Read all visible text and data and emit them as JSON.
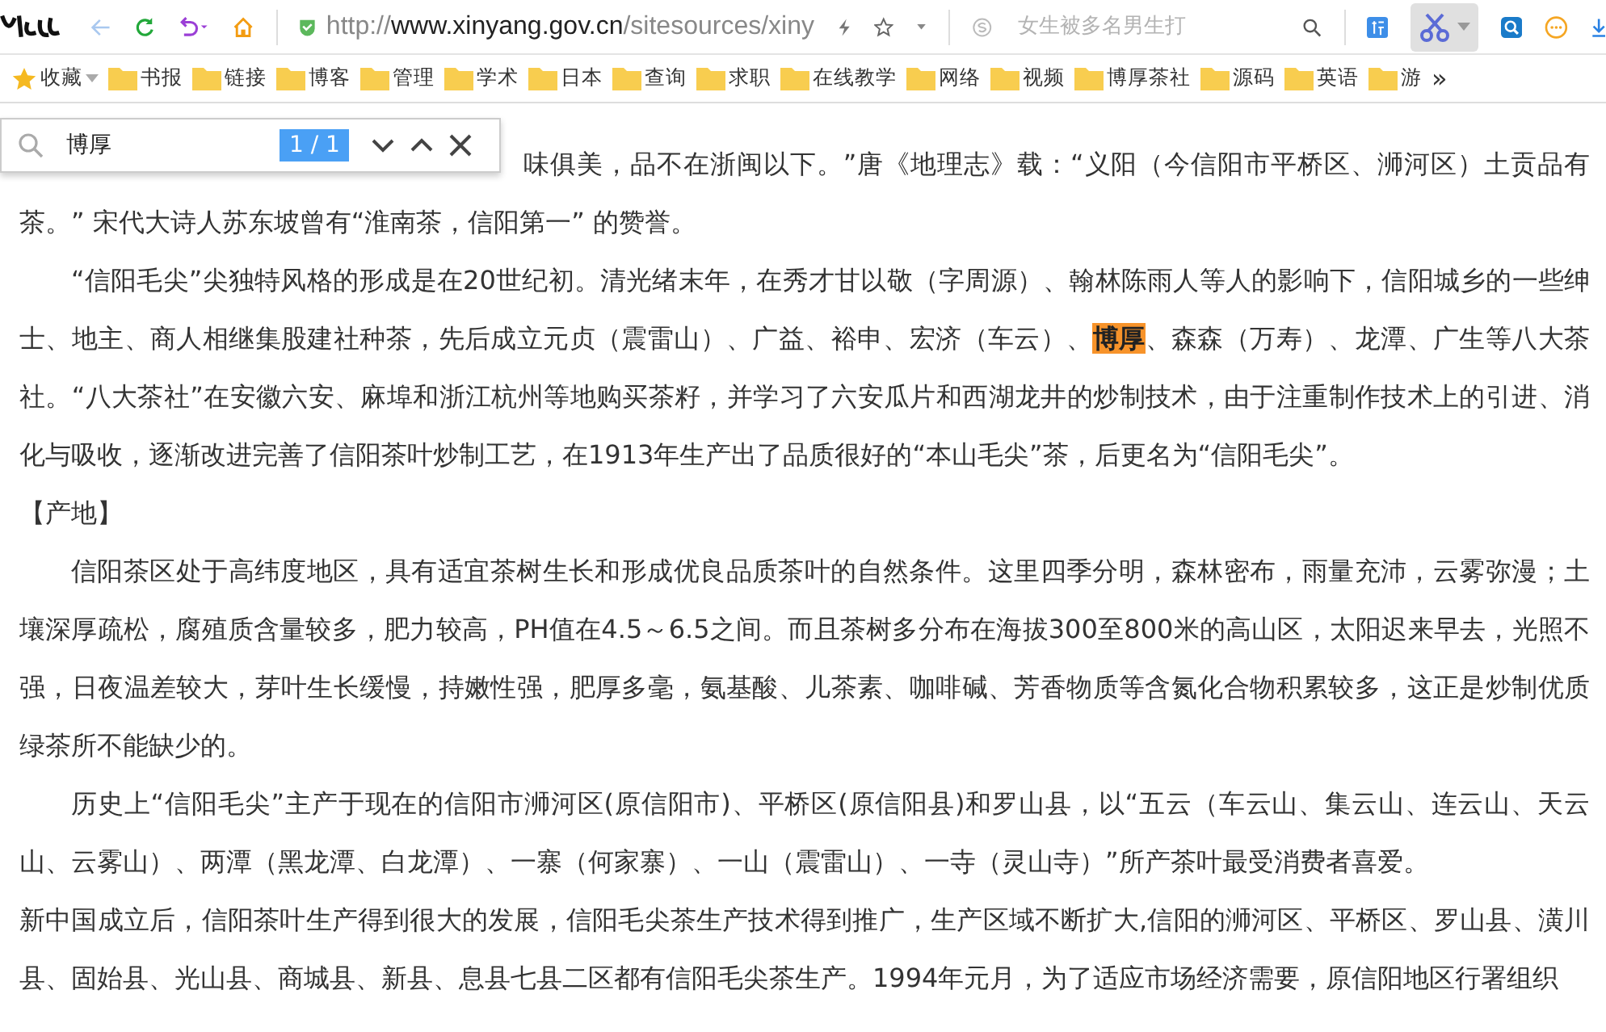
{
  "toolbar": {
    "back_disabled": true,
    "url": {
      "scheme": "http://",
      "domain": "www.xinyang.gov.cn",
      "path": "/sitesources/xiny"
    },
    "search": {
      "placeholder": "女生被多名男生打"
    },
    "scissors_selected": true
  },
  "bookmarks": [
    {
      "label": "收藏",
      "kind": "favorites"
    },
    {
      "label": "书报",
      "kind": "folder"
    },
    {
      "label": "链接",
      "kind": "folder"
    },
    {
      "label": "博客",
      "kind": "folder"
    },
    {
      "label": "管理",
      "kind": "folder"
    },
    {
      "label": "学术",
      "kind": "folder"
    },
    {
      "label": "日本",
      "kind": "folder"
    },
    {
      "label": "查询",
      "kind": "folder"
    },
    {
      "label": "求职",
      "kind": "folder"
    },
    {
      "label": "在线教学",
      "kind": "folder"
    },
    {
      "label": "网络",
      "kind": "folder"
    },
    {
      "label": "视频",
      "kind": "folder"
    },
    {
      "label": "博厚茶社",
      "kind": "folder"
    },
    {
      "label": "源码",
      "kind": "folder"
    },
    {
      "label": "英语",
      "kind": "folder"
    },
    {
      "label": "游",
      "kind": "folder"
    },
    {
      "label": "»",
      "kind": "more"
    }
  ],
  "find_bar": {
    "value": "博厚",
    "count": "1 / 1"
  },
  "paragraphs": [
    {
      "indent": false,
      "lines": [
        [
          {
            "text": "味俱美，品不在浙闽以下。”唐《地理志》载：“义阳（今信阳市平桥区、浉河区）土贡品有",
            "highlight": false
          }
        ],
        [
          {
            "text": "茶。” 宋代大诗人苏东坡曾有“淮南茶，信阳第一” 的赞誉。",
            "highlight": false
          }
        ]
      ]
    },
    {
      "indent": true,
      "lines": [
        [
          {
            "text": "“信阳毛尖”尖独特风格的形成是在20世纪初。清光绪末年，在秀才甘以敬（字周源）、翰林陈雨人等人的影响下，信阳城乡的一些绅",
            "highlight": false
          }
        ],
        [
          {
            "text": "士、地主、商人相继集股建社种茶，先后成立元贞（震雷山）、广益、裕申、宏济（车云）、",
            "highlight": false
          },
          {
            "text": "博厚",
            "highlight": true
          },
          {
            "text": "、森森（万寿）、龙潭、广生等八大茶",
            "highlight": false
          }
        ],
        [
          {
            "text": "社。“八大茶社”在安徽六安、麻埠和浙江杭州等地购买茶籽，并学习了六安瓜片和西湖龙井的炒制技术，由于注重制作技术上的引进、消",
            "highlight": false
          }
        ],
        [
          {
            "text": "化与吸收，逐渐改进完善了信阳茶叶炒制工艺，在1913年生产出了品质很好的“本山毛尖”茶，后更名为“信阳毛尖”。",
            "highlight": false
          }
        ]
      ]
    },
    {
      "indent": false,
      "lines": [
        [
          {
            "text": "【产地】",
            "highlight": false
          }
        ]
      ]
    },
    {
      "indent": true,
      "lines": [
        [
          {
            "text": "信阳茶区处于高纬度地区，具有适宜茶树生长和形成优良品质茶叶的自然条件。这里四季分明，森林密布，雨量充沛，云雾弥漫；土",
            "highlight": false
          }
        ],
        [
          {
            "text": "壤深厚疏松，腐殖质含量较多，肥力较高，PH值在4.5～6.5之间。而且茶树多分布在海拔300至800米的高山区，太阳迟来早去，光照不",
            "highlight": false
          }
        ],
        [
          {
            "text": "强，日夜温差较大，芽叶生长缓慢，持嫩性强，肥厚多毫，氨基酸、儿茶素、咖啡碱、芳香物质等含氮化合物积累较多，这正是炒制优质",
            "highlight": false
          }
        ],
        [
          {
            "text": "绿茶所不能缺少的。",
            "highlight": false
          }
        ]
      ]
    },
    {
      "indent": true,
      "lines": [
        [
          {
            "text": "历史上“信阳毛尖”主产于现在的信阳市浉河区(原信阳市)、平桥区(原信阳县)和罗山县，以“五云（车云山、集云山、连云山、天云",
            "highlight": false
          }
        ],
        [
          {
            "text": "山、云雾山）、两潭（黑龙潭、白龙潭）、一寨（何家寨）、一山（震雷山）、一寺（灵山寺）”所产茶叶最受消费者喜爱。",
            "highlight": false
          }
        ]
      ]
    },
    {
      "indent": false,
      "lines": [
        [
          {
            "text": "新中国成立后，信阳茶叶生产得到很大的发展，信阳毛尖茶生产技术得到推广，生产区域不断扩大,信阳的浉河区、平桥区、罗山县、潢川",
            "highlight": false
          }
        ],
        [
          {
            "text": "县、固始县、光山县、商城县、新县、息县七县二区都有信阳毛尖茶生产。1994年元月，为了适应市场经济需要，原信阳地区行署组织",
            "highlight": false
          }
        ]
      ]
    }
  ]
}
